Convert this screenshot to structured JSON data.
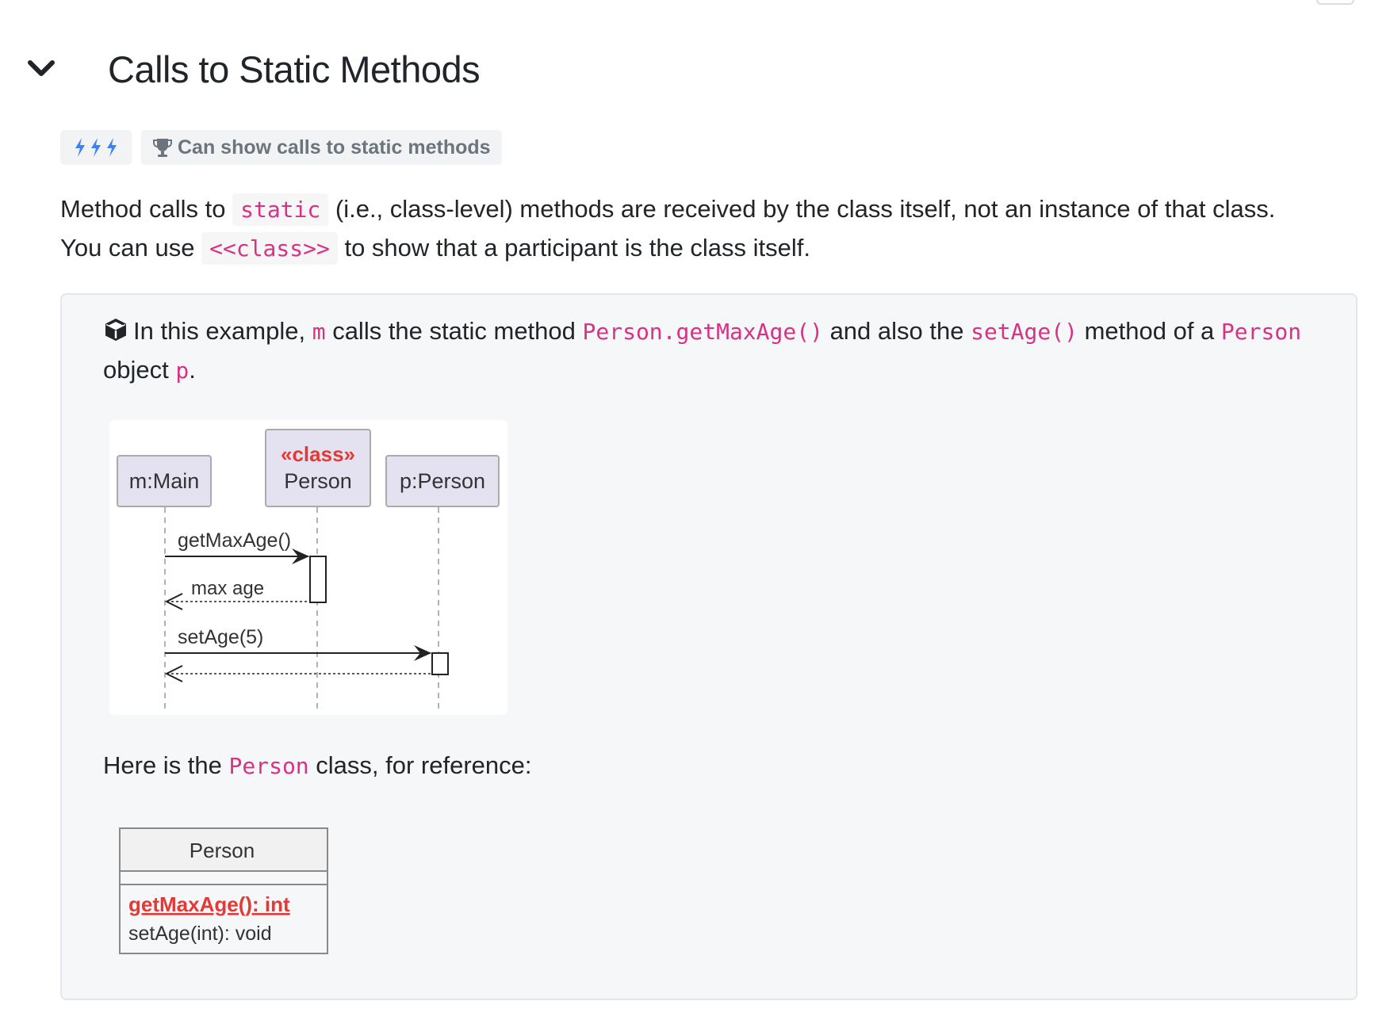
{
  "section": {
    "title": "Calls to Static Methods",
    "collapse_icon": "chevron-down-icon"
  },
  "badges": {
    "level_icon": "lightning-icon",
    "level_count": 3,
    "trophy_icon": "trophy-icon",
    "trophy_text": "Can show calls to static methods"
  },
  "intro": {
    "p1": "Method calls to ",
    "code_static": "static",
    "p2": " (i.e., class-level) methods are received by the class itself, not an instance of that class.",
    "p3": "You can use ",
    "code_class": "<<class>>",
    "p4": " to show that a participant is the class itself."
  },
  "example": {
    "icon": "cube-icon",
    "t1": "In this example, ",
    "c1": "m",
    "t2": " calls the static method ",
    "c2": "Person.getMaxAge()",
    "t3": " and also the ",
    "c3": "setAge()",
    "t4": " method of a ",
    "c4": "Person",
    "t5": " object ",
    "c5": "p",
    "t6": "."
  },
  "sequence_diagram": {
    "participants": {
      "main": "m:Main",
      "person_stereotype": "«class»",
      "person_class": "Person",
      "person_obj": "p:Person"
    },
    "messages": {
      "call1": "getMaxAge()",
      "return1": "max age",
      "call2": "setAge(5)"
    }
  },
  "reference": {
    "t1": "Here is the ",
    "code": "Person",
    "t2": " class, for reference:"
  },
  "class_diagram": {
    "name": "Person",
    "static_method": "getMaxAge(): int",
    "method": "setAge(int): void"
  },
  "colors": {
    "code": "#d63384",
    "badge_bg": "#f1f3f5",
    "lightning": "#3b82f6",
    "participant_fill": "#e4e2f0",
    "stereotype": "#e53935",
    "static_method": "#e53935"
  }
}
